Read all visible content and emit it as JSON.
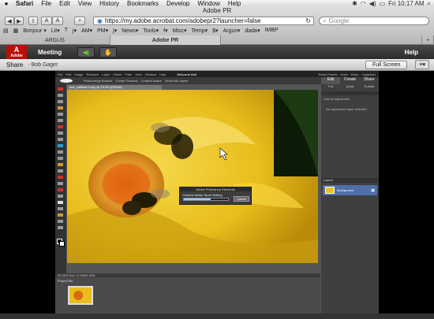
{
  "menubar": {
    "items": [
      "Safari",
      "File",
      "Edit",
      "View",
      "History",
      "Bookmarks",
      "Develop",
      "Window",
      "Help"
    ],
    "clock": "Fri 10:17 AM"
  },
  "browser": {
    "window_title": "Adobe PR",
    "url": "https://my.adobe.acrobat.com/adobepr2?launcher=false",
    "search_placeholder": "Google",
    "bookmarks": [
      "Bonjour ▾",
      "Lit▾",
      "T",
      "j▾",
      "AM▾",
      "PM▾",
      "j▾",
      "News▾",
      "Tools▾",
      "f▾",
      "Misc▾",
      "Temp▾",
      "$▾",
      "Argus▾",
      "dada▾",
      "IMBP"
    ],
    "tabs": [
      "ARGUS",
      "Adobe PR"
    ],
    "active_tab": 1
  },
  "connect": {
    "logo_text": "Adobe",
    "meeting_label": "Meeting",
    "help_label": "Help",
    "share_label": "Share",
    "presenter": "- Bob Gager",
    "fullscreen_label": "Full Screen"
  },
  "pse": {
    "app_name": "Photoshop Elements",
    "menu": [
      "File",
      "Edit",
      "Image",
      "Enhance",
      "Layer",
      "Select",
      "Filter",
      "View",
      "Window",
      "Help"
    ],
    "top_buttons": [
      "Welcome Bob",
      "Reset Panels",
      "Undo",
      "Redo",
      "Organizer"
    ],
    "options_tabs": [
      "Photomerge Bounce",
      "Create Textures",
      "Content Aware",
      "Select All Layers"
    ],
    "doc_tab": "bee_catflash Copy @ 33.3% (RGB/8)",
    "panel_tabs": [
      "Edit",
      "Create",
      "Share"
    ],
    "panel_subtabs": [
      "Full",
      "Quick",
      "Guided"
    ],
    "panel_text_1": "Add an adjustment",
    "panel_text_2": "No adjustment layer selected",
    "layers_label": "Layers",
    "layer_name": "Background",
    "status": "33.33%  Doc: 5.42M/5.42M",
    "bin_label": "Project Bin",
    "dialog_title": "Adobe Photoshop Elements",
    "dialog_text": "Content-Aware Spot Healing",
    "dialog_cancel": "Cancel"
  },
  "colors": {
    "accent": "#f0c417",
    "toolbar": "#2f2f2f"
  }
}
